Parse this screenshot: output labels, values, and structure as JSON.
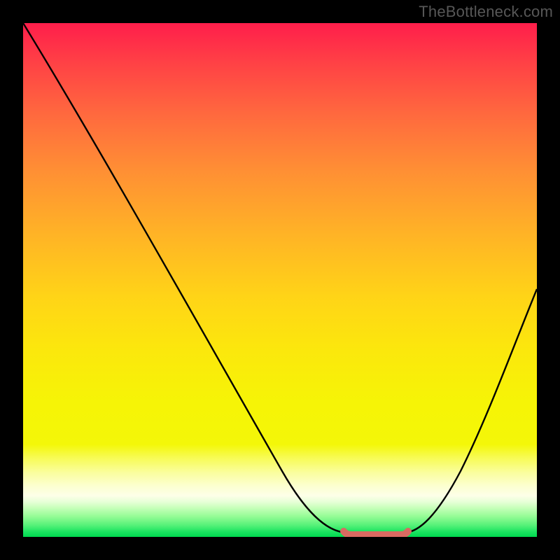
{
  "watermark": "TheBottleneck.com",
  "chart_data": {
    "type": "line",
    "title": "",
    "xlabel": "",
    "ylabel": "",
    "ylim": [
      0,
      100
    ],
    "xlim": [
      0,
      100
    ],
    "x": [
      0,
      5,
      10,
      15,
      20,
      25,
      30,
      35,
      40,
      45,
      50,
      55,
      60,
      64,
      67,
      70,
      72,
      75,
      80,
      85,
      90,
      95,
      100
    ],
    "values": [
      100,
      93,
      86,
      79,
      72,
      64,
      56,
      48,
      40,
      32,
      24,
      16,
      8,
      2,
      0,
      0,
      0,
      2,
      10,
      20,
      31,
      42,
      54
    ],
    "flat_zone": {
      "x_start": 64,
      "x_end": 74,
      "y": 0
    },
    "colors": {
      "curve": "#000000",
      "flat_highlight": "#d96a61",
      "gradient_top": "#ff1e4b",
      "gradient_mid": "#f6f406",
      "gradient_bottom": "#00d94f",
      "frame": "#000000",
      "watermark": "#575757"
    }
  }
}
